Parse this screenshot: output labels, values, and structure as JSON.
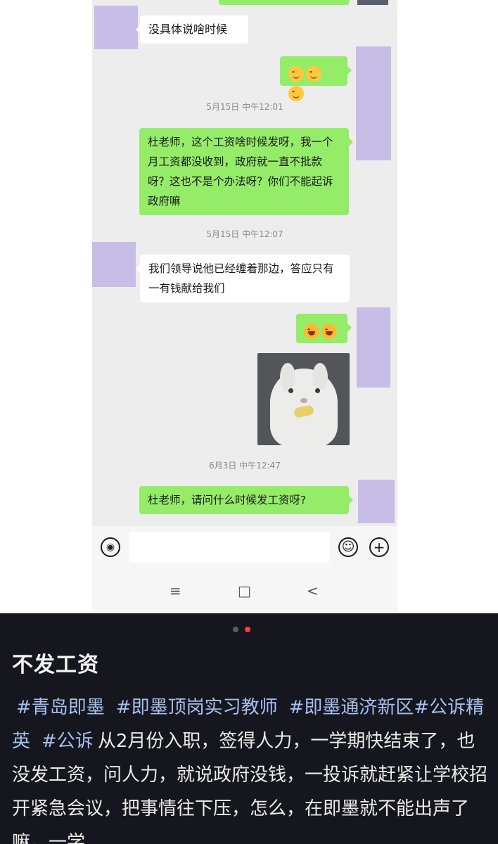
{
  "messages": {
    "m1": "没具体说啥时候",
    "ts1": "5月15日 中午12:01",
    "m3": "杜老师，这个工资啥时候发呀，我一个月工资都没收到，政府就一直不批款呀？这也不是个办法呀？你们不能起诉政府嘛",
    "ts2": "5月15日 中午12:07",
    "m4": "我们领导说他已经缠着那边，答应只有一有钱献给我们",
    "ts3": "6月3日 中午12:47",
    "m6": "杜老师，请问什么时候发工资呀?"
  },
  "emoji": {
    "smile": "smiling-face-icon",
    "laugh": "tears-of-joy-icon"
  },
  "sticker": "rabbit-sticker",
  "input_bar": {
    "voice": "voice-icon",
    "emoji": "emoji-icon",
    "add": "plus-icon",
    "voice_glyph": "◉",
    "emoji_glyph": "☺",
    "add_glyph": "+"
  },
  "nav": {
    "menu": "≡",
    "home": "□",
    "back": "<"
  },
  "post": {
    "title": "不发工资",
    "tags": [
      "#青岛即墨",
      "#即墨顶岗实习教师",
      "#即墨通济新区",
      "#公诉精英",
      "#公诉"
    ],
    "body": "从2月份入职，签得人力，一学期快结束了，也没发工资，问人力，就说政府没钱，一投诉就赶紧让学校招开紧急会议，把事情往下压，怎么，在即墨就不能出声了嘛，一学"
  },
  "colors": {
    "sent_bubble": "#95ec69",
    "received_bubble": "#ffffff",
    "chat_bg": "#ededed",
    "caption_bg": "#16161e",
    "tag_color": "#a4c1ee",
    "page_dot_active": "#ff3b4a",
    "page_dot_inactive": "#5a5a62"
  }
}
